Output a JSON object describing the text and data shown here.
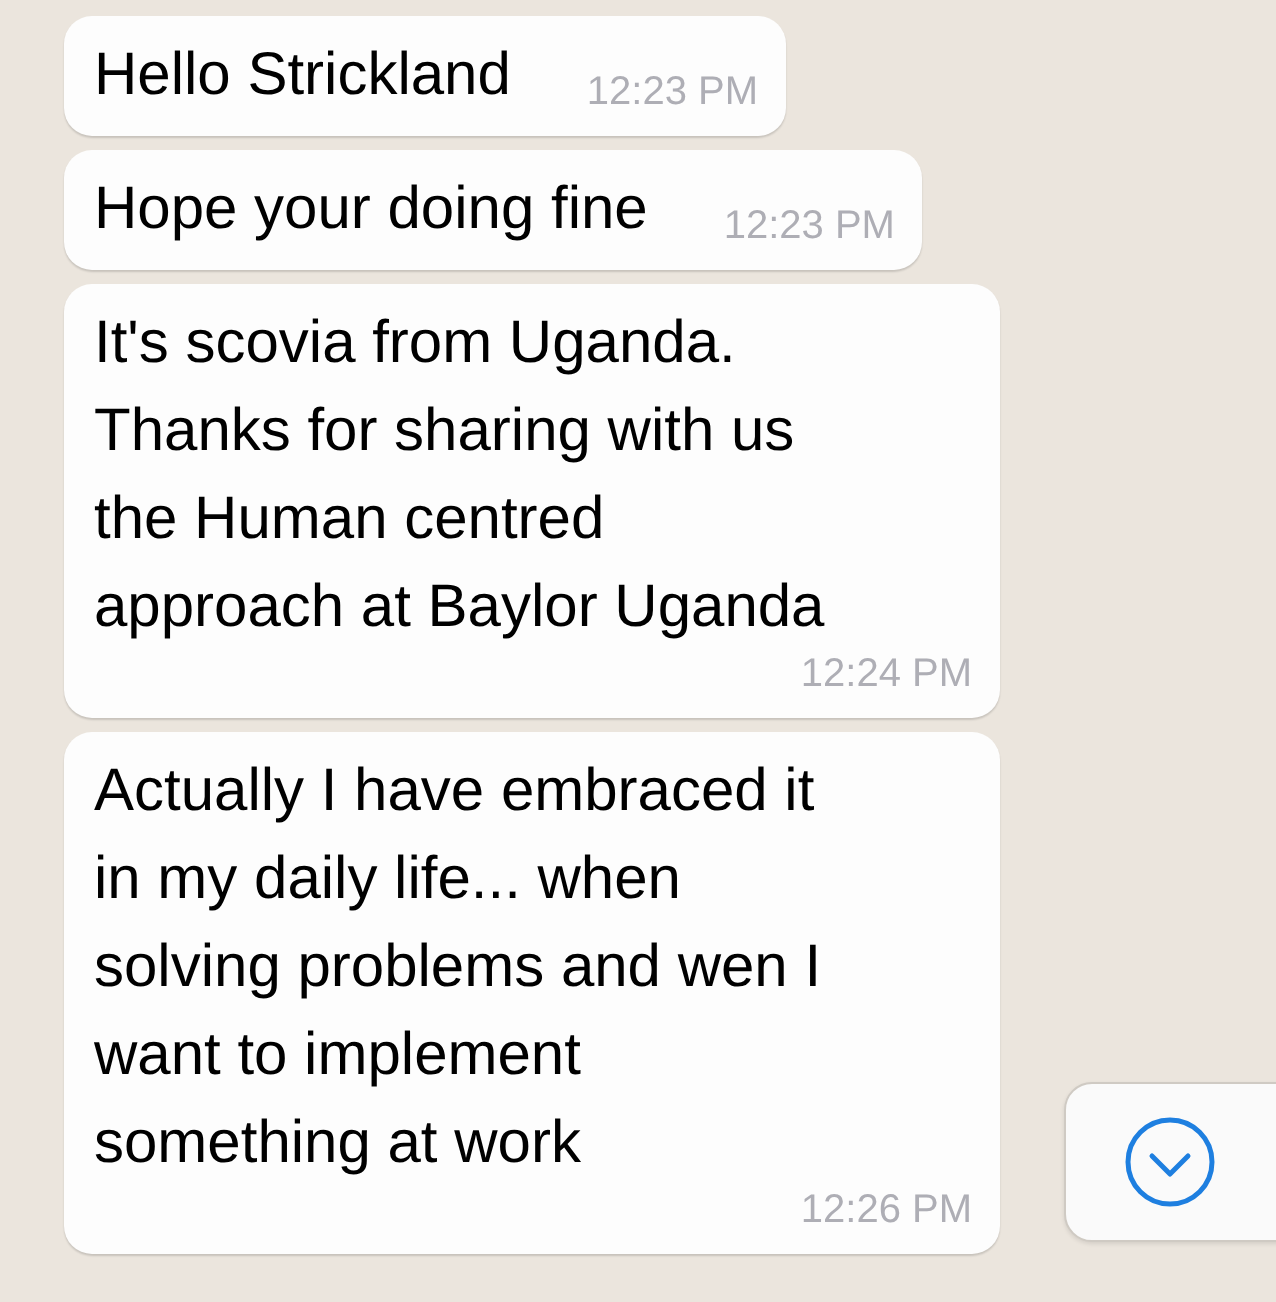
{
  "messages": [
    {
      "text": "Hello Strickland",
      "time": "12:23 PM"
    },
    {
      "text": "Hope your doing fine",
      "time": "12:23 PM"
    },
    {
      "text": "It's scovia from Uganda.\nThanks for sharing with us\nthe Human centred\napproach at Baylor Uganda",
      "time": "12:24 PM"
    },
    {
      "text": "Actually I have embraced it\nin my daily life... when\nsolving problems and wen I\nwant to implement\nsomething at work",
      "time": "12:26 PM"
    }
  ]
}
